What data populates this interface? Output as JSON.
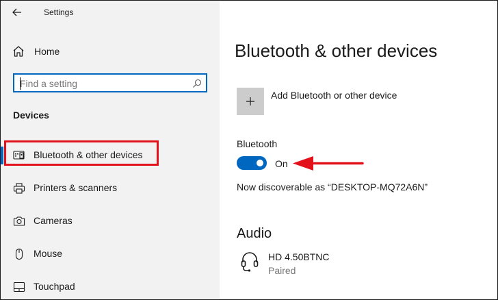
{
  "window": {
    "title": "Settings"
  },
  "sidebar": {
    "home_label": "Home",
    "search": {
      "placeholder": "Find a setting"
    },
    "section_heading": "Devices",
    "items": [
      {
        "label": "Bluetooth & other devices",
        "icon": "bluetooth-devices-icon",
        "selected": true
      },
      {
        "label": "Printers & scanners",
        "icon": "printer-icon",
        "selected": false
      },
      {
        "label": "Cameras",
        "icon": "camera-icon",
        "selected": false
      },
      {
        "label": "Mouse",
        "icon": "mouse-icon",
        "selected": false
      },
      {
        "label": "Touchpad",
        "icon": "touchpad-icon",
        "selected": false
      }
    ]
  },
  "main": {
    "title": "Bluetooth & other devices",
    "add_device_label": "Add Bluetooth or other device",
    "bluetooth": {
      "label": "Bluetooth",
      "state": "On",
      "enabled": true
    },
    "discoverable_text": "Now discoverable as “DESKTOP-MQ72A6N”",
    "audio": {
      "heading": "Audio",
      "devices": [
        {
          "name": "HD 4.50BTNC",
          "status": "Paired",
          "icon": "headset-icon"
        }
      ]
    }
  },
  "colors": {
    "accent": "#0067c0",
    "highlight": "#e3121a",
    "sidebar_bg": "#f2f2f2"
  }
}
